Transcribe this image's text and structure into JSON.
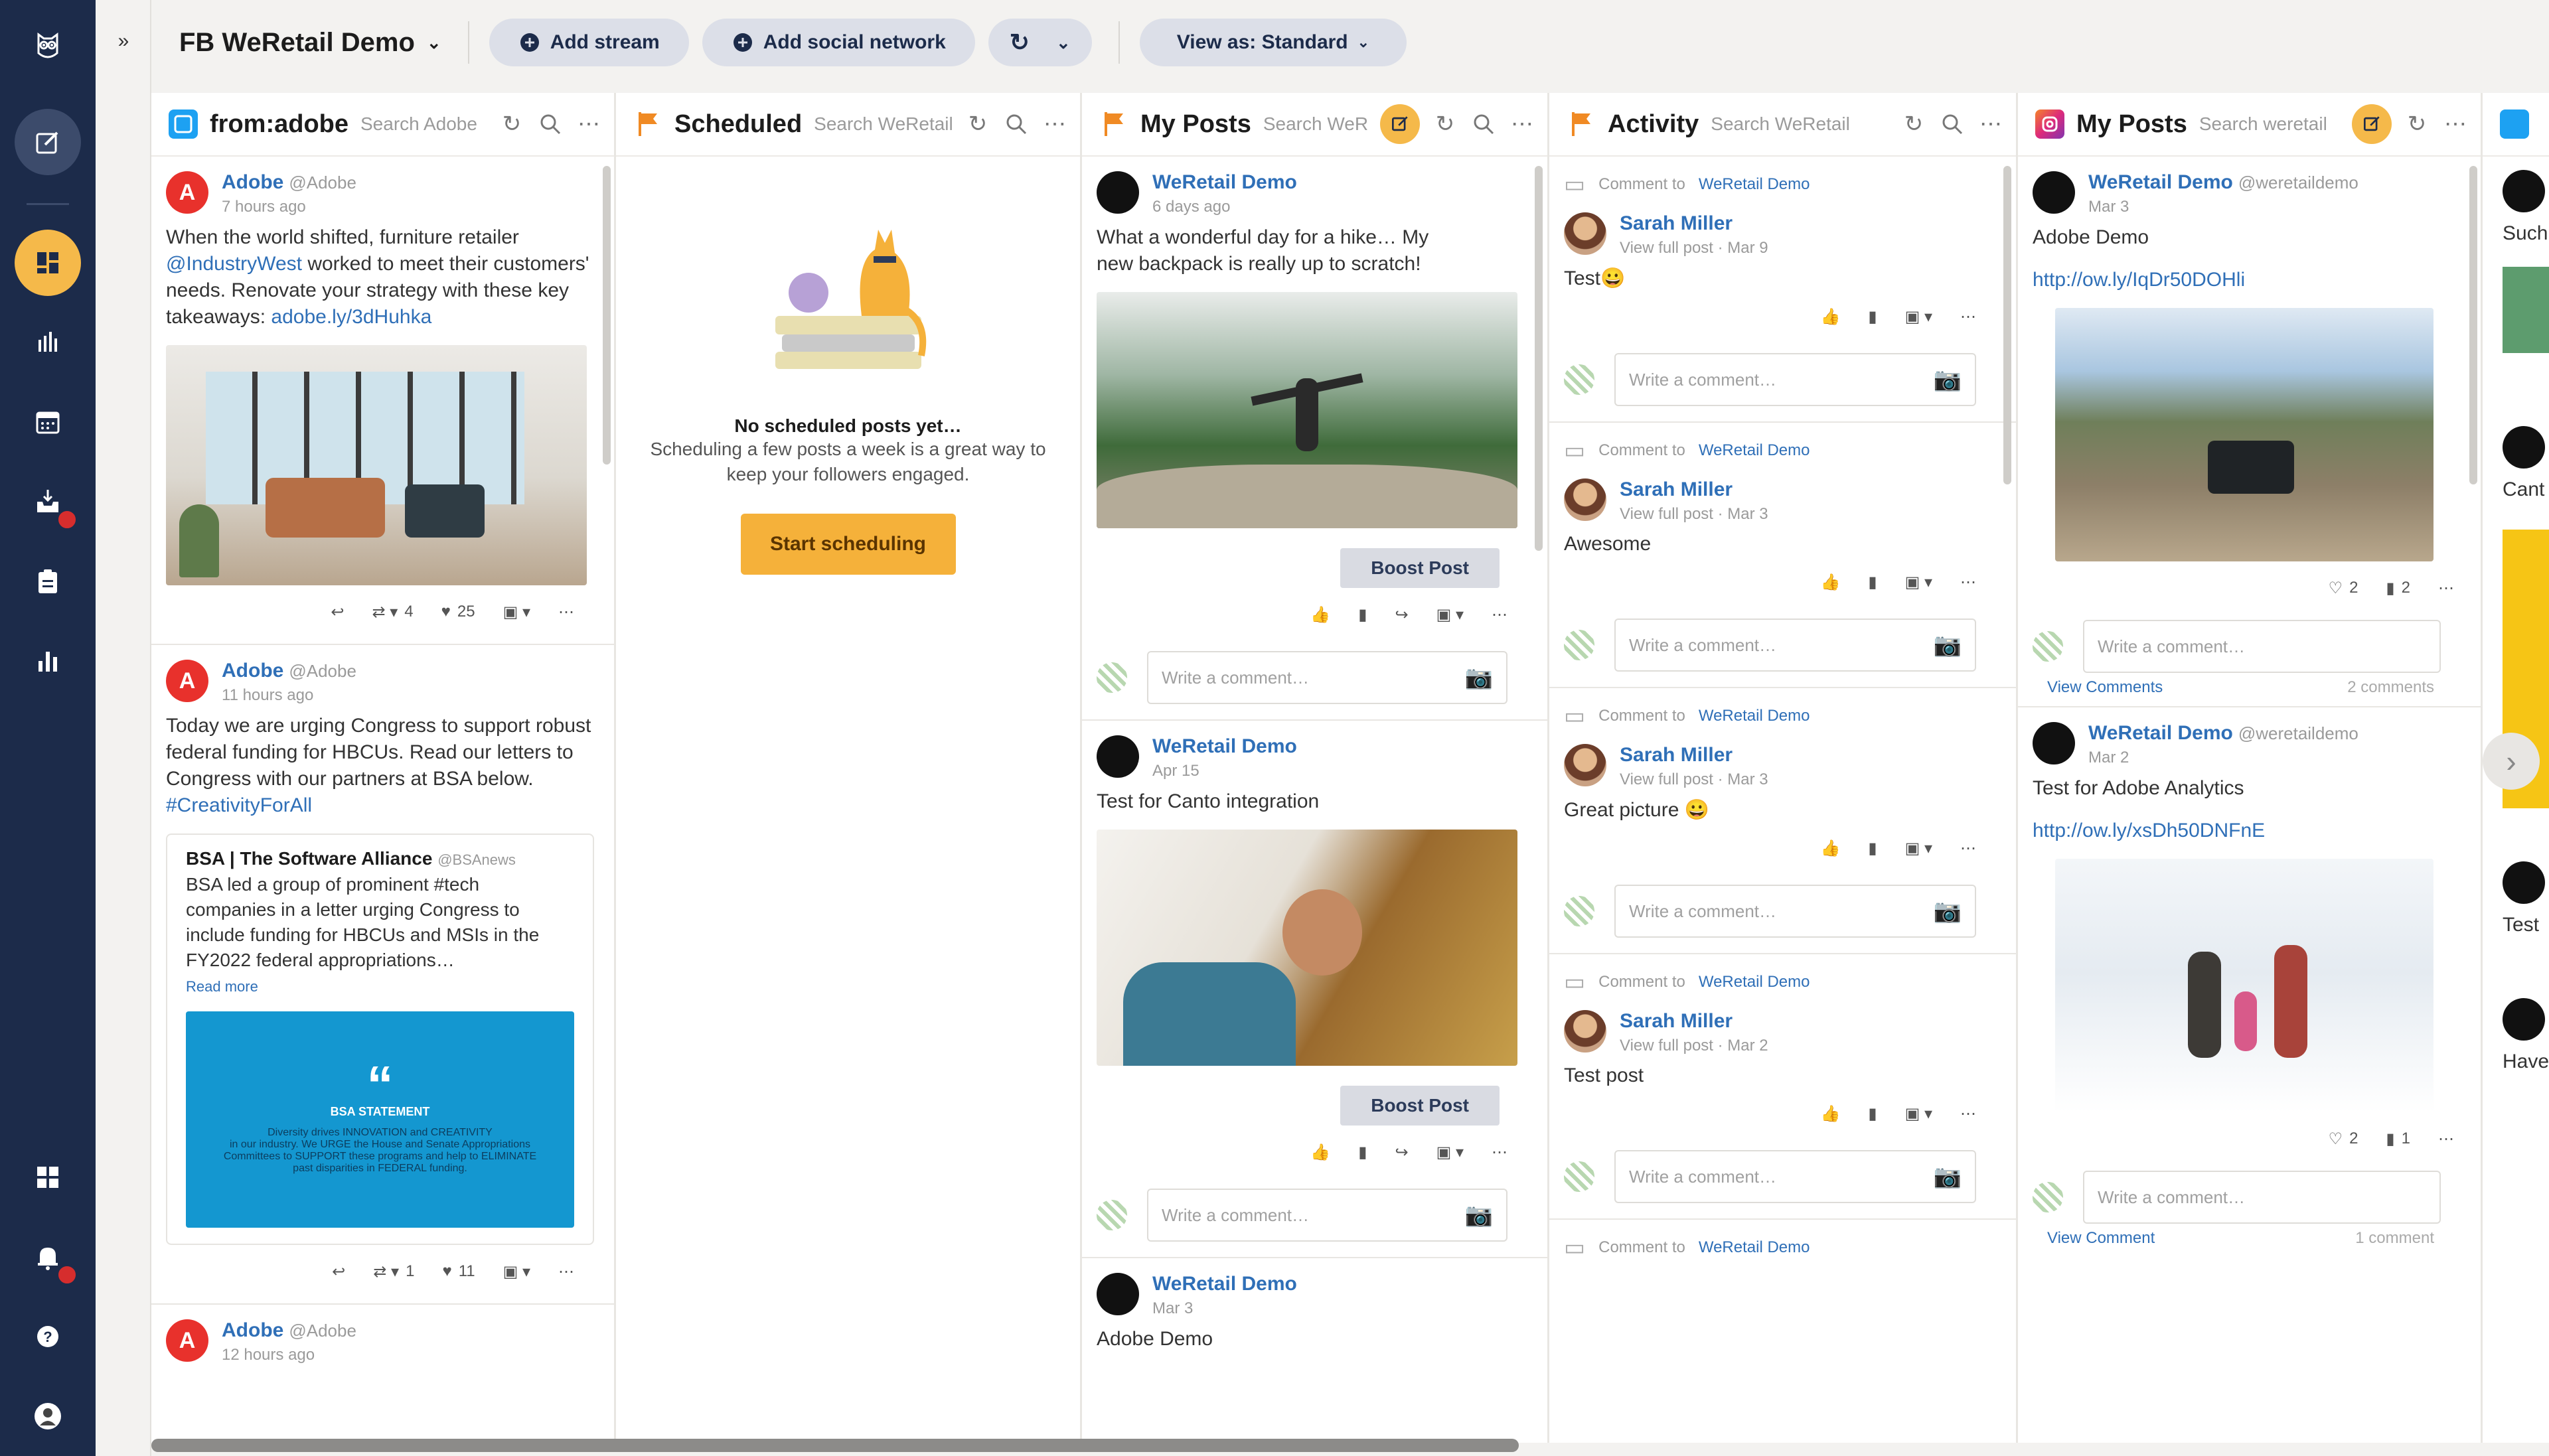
{
  "app": {
    "board_title": "FB WeRetail Demo",
    "buttons": {
      "add_stream": "Add stream",
      "add_social": "Add social network",
      "view_as": "View as: Standard"
    }
  },
  "sidebar": {
    "items": [
      "owl-logo",
      "compose",
      "streams",
      "analytics",
      "planner",
      "inbox",
      "assignments",
      "reports",
      "apps",
      "notifications",
      "help",
      "profile"
    ]
  },
  "streams": [
    {
      "title": "from:adobe",
      "search": "Search Adobe",
      "network": "twitter",
      "posts": [
        {
          "author": "Adobe",
          "handle": "@Adobe",
          "time": "7 hours ago",
          "text_1": "When the world shifted, furniture retailer",
          "text_link": "@IndustryWest",
          "text_2": "worked to meet their customers' needs. Renovate your strategy with these key takeaways:",
          "text_link2": "adobe.ly/3dHuhka",
          "stats": {
            "retweets": "4",
            "likes": "25"
          }
        },
        {
          "author": "Adobe",
          "handle": "@Adobe",
          "time": "11 hours ago",
          "text": "Today we are urging Congress to support robust federal funding for HBCUs. Read our letters to Congress with our partners at BSA below.",
          "hashtag": "#CreativityForAll",
          "quote": {
            "title": "BSA | The Software Alliance",
            "handle": "@BSAnews",
            "text": "BSA led a group of prominent #tech companies in a letter urging Congress to include funding for HBCUs and MSIs in the FY2022 federal appropriations…",
            "more": "Read more",
            "card_heading": "BSA STATEMENT",
            "card_line1": "Diversity drives INNOVATION and CREATIVITY",
            "card_line2": "in our industry. We URGE the House and Senate Appropriations",
            "card_line3": "Committees to SUPPORT these programs and help to ELIMINATE past disparities in FEDERAL funding."
          },
          "stats": {
            "retweets": "1",
            "likes": "11"
          }
        },
        {
          "author": "Adobe",
          "handle": "@Adobe",
          "time": "12 hours ago"
        }
      ]
    },
    {
      "title": "Scheduled",
      "search": "Search WeRetail",
      "empty_title": "No scheduled posts yet…",
      "empty_sub": "Scheduling a few posts a week is a great way to keep your followers engaged.",
      "cta": "Start scheduling"
    },
    {
      "title": "My Posts",
      "search": "Search WeRetail",
      "posts": [
        {
          "author": "WeRetail Demo",
          "time": "6 days ago",
          "text": "What a wonderful day for a hike… My new backpack is really up to scratch!",
          "boost": "Boost Post"
        },
        {
          "author": "WeRetail Demo",
          "time": "Apr 15",
          "text": "Test for Canto integration",
          "boost": "Boost Post"
        },
        {
          "author": "WeRetail Demo",
          "time": "Mar 3",
          "text": "Adobe Demo"
        }
      ],
      "comment_placeholder": "Write a comment…"
    },
    {
      "title": "Activity",
      "search": "Search WeRetail",
      "items": [
        {
          "label": "Comment to",
          "target": "WeRetail Demo",
          "author": "Sarah Miller",
          "meta": "View full post · Mar 9",
          "text": "Test😀"
        },
        {
          "label": "Comment to",
          "target": "WeRetail Demo",
          "author": "Sarah Miller",
          "meta": "View full post · Mar 3",
          "text": "Awesome"
        },
        {
          "label": "Comment to",
          "target": "WeRetail Demo",
          "author": "Sarah Miller",
          "meta": "View full post · Mar 3",
          "text": "Great picture 😀"
        },
        {
          "label": "Comment to",
          "target": "WeRetail Demo",
          "author": "Sarah Miller",
          "meta": "View full post · Mar 2",
          "text": "Test post"
        },
        {
          "label": "Comment to",
          "target": "WeRetail Demo"
        }
      ],
      "comment_placeholder": "Write a comment…"
    },
    {
      "title": "My Posts",
      "search": "Search weretail",
      "network": "instagram",
      "posts": [
        {
          "author": "WeRetail Demo",
          "handle": "@weretaildemo",
          "time": "Mar 3",
          "text": "Adobe Demo",
          "link": "http://ow.ly/IqDr50DOHli",
          "likes": "2",
          "comments": "2",
          "view_comments": "View Comments",
          "count": "2 comments"
        },
        {
          "author": "WeRetail Demo",
          "handle": "@weretaildemo",
          "time": "Mar 2",
          "text": "Test for Adobe Analytics",
          "link": "http://ow.ly/xsDh50DNFnE",
          "likes": "2",
          "comments": "1",
          "view_comments": "View Comment",
          "count": "1 comment"
        }
      ],
      "comment_placeholder": "Write a comment…"
    },
    {
      "title": "",
      "partial_texts": [
        "Such",
        "Cant",
        "Test",
        "Have"
      ]
    }
  ]
}
